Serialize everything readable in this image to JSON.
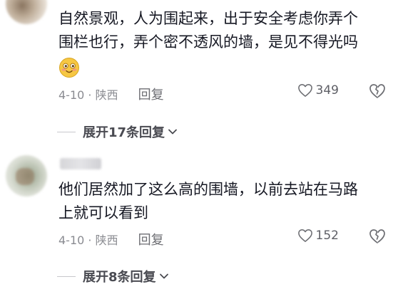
{
  "comments": [
    {
      "text_lines": [
        "自然景观，人为围起来，出于安全考虑你弄个",
        "围栏也行，弄个密不透风的墙，是见不得光吗"
      ],
      "emoji": "smiling-blush-emoji",
      "meta": "4-10 · 陕西",
      "reply_label": "回复",
      "likes": "349",
      "expand_label": "展开17条回复"
    },
    {
      "text_lines": [
        "他们居然加了这么高的围墙，以前去站在马路",
        "上就可以看到"
      ],
      "meta": "4-10 · 陕西",
      "reply_label": "回复",
      "likes": "152",
      "expand_label": "展开8条回复"
    }
  ],
  "colors": {
    "text": "#161823",
    "meta": "#8a8b91",
    "expand": "#4a4b52",
    "emoji_face": "#f6c743"
  }
}
